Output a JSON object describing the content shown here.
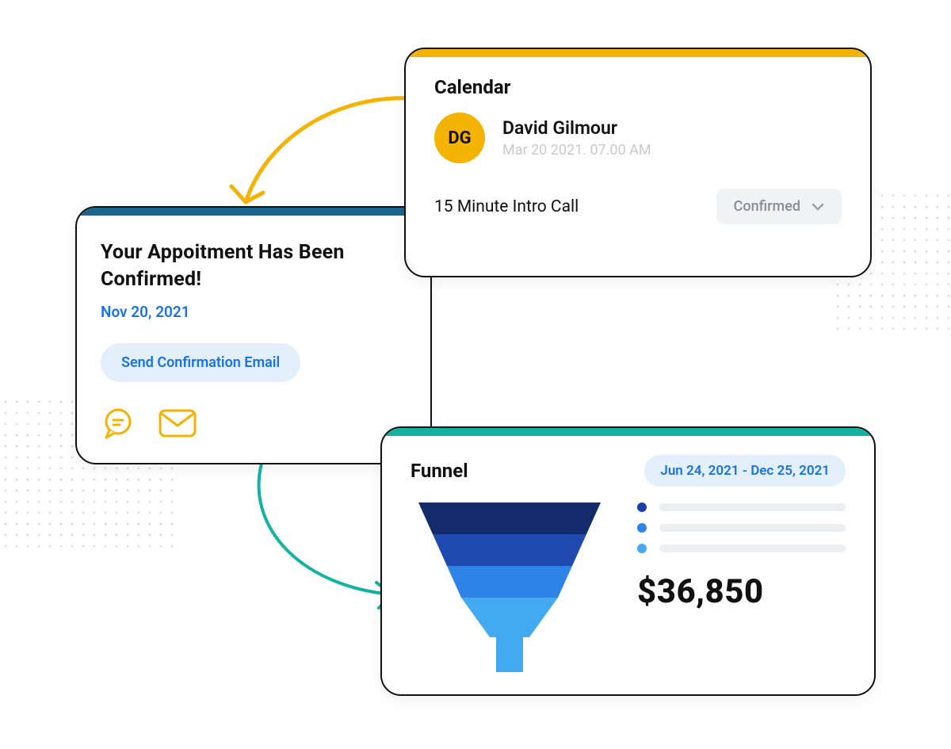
{
  "appointment": {
    "title": "Your Appoitment Has Been Confirmed!",
    "date": "Nov 20, 2021",
    "action_label": "Send Confirmation Email"
  },
  "calendar": {
    "title": "Calendar",
    "avatar_initials": "DG",
    "name": "David Gilmour",
    "when": "Mar 20 2021. 07.00 AM",
    "call_type": "15 Minute Intro Call",
    "status": "Confirmed"
  },
  "funnel": {
    "title": "Funnel",
    "range": "Jun 24, 2021 -  Dec 25, 2021",
    "amount": "$36,850",
    "legend_colors": [
      "#1f3fa8",
      "#2f82e6",
      "#43a9f0"
    ]
  },
  "chart_data": {
    "type": "funnel",
    "title": "Funnel",
    "stages": [
      {
        "color": "#152a6b",
        "relative_width": 1.0
      },
      {
        "color": "#2049b0",
        "relative_width": 0.8
      },
      {
        "color": "#2f82e6",
        "relative_width": 0.6
      },
      {
        "color": "#43a9f0",
        "relative_width": 0.4
      }
    ],
    "spout_color": "#43a9f0",
    "total_label": "$36,850",
    "date_range": "Jun 24, 2021 - Dec 25, 2021"
  }
}
